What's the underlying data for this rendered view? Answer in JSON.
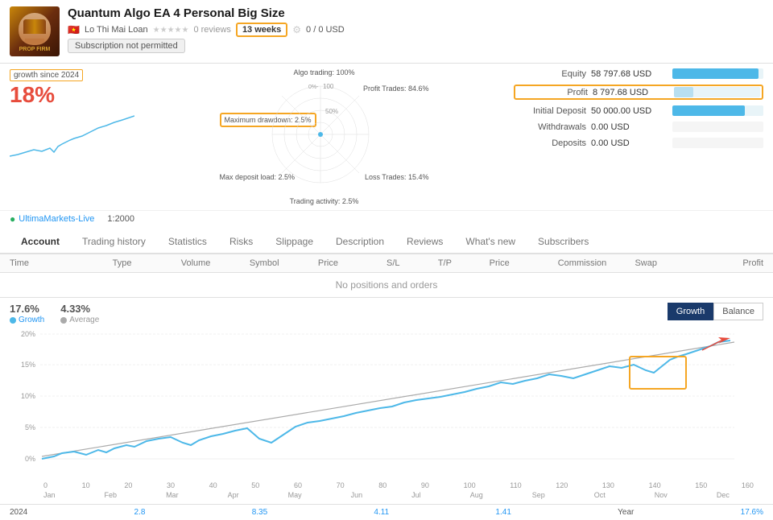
{
  "header": {
    "title": "Quantum Algo EA 4 Personal Big Size",
    "broker": "Lo Thi Mai Loan",
    "flag": "🇻🇳",
    "stars": "★★★★★",
    "reviews": "0 reviews",
    "weeks": "13 weeks",
    "usd_info": "0 / 0 USD",
    "subscription": "Subscription not permitted"
  },
  "growth": {
    "label": "growth since 2024",
    "value": "18%"
  },
  "radar": {
    "algo_trading": "Algo trading: 100%",
    "profit_trades": "Profit Trades:\n84.6%",
    "loss_trades": "Loss Trades: 15.4%",
    "trading_activity": "Trading activity: 2.5%",
    "max_drawdown": "Maximum\ndrawdown: 2.5%",
    "max_deposit_load": "Max deposit load:\n2.5%",
    "center_label": "50%"
  },
  "stats": {
    "equity_label": "Equity",
    "equity_value": "58 797.68 USD",
    "equity_bar_width": "95",
    "profit_label": "Profit",
    "profit_value": "8 797.68 USD",
    "profit_bar_width": "20",
    "initial_label": "Initial Deposit",
    "initial_value": "50 000.00 USD",
    "initial_bar_width": "80",
    "withdrawals_label": "Withdrawals",
    "withdrawals_value": "0.00 USD",
    "deposits_label": "Deposits",
    "deposits_value": "0.00 USD"
  },
  "footer": {
    "broker_live": "UltimaMarkets-Live",
    "leverage": "1:2000"
  },
  "tabs": [
    "Account",
    "Trading history",
    "Statistics",
    "Risks",
    "Slippage",
    "Description",
    "Reviews",
    "What's new",
    "Subscribers"
  ],
  "active_tab": "Account",
  "table_headers": [
    "Time",
    "Type",
    "Volume",
    "Symbol",
    "Price",
    "S/L",
    "T/P",
    "Price",
    "Commission",
    "Swap",
    "Profit"
  ],
  "no_data_msg": "No positions and orders",
  "chart": {
    "value1": "17.6%",
    "value2": "4.33%",
    "label1": "Growth",
    "label2": "Average",
    "btn_growth": "Growth",
    "btn_balance": "Balance",
    "y_labels": [
      "20%",
      "15%",
      "10%",
      "5%",
      "0%"
    ],
    "x_numbers": [
      "0",
      "10",
      "20",
      "30",
      "40",
      "50",
      "60",
      "70",
      "80",
      "90",
      "100",
      "110",
      "120",
      "130",
      "140",
      "150",
      "160"
    ],
    "month_labels": [
      "Jan",
      "Feb",
      "Mar",
      "Apr",
      "May",
      "Jun",
      "Jul",
      "Aug",
      "Sep",
      "Oct",
      "Nov",
      "Dec"
    ],
    "year_label": "2024",
    "year_values": [
      {
        "label": "2.8",
        "color": "blue"
      },
      {
        "label": "8.35",
        "color": "blue"
      },
      {
        "label": "4.11",
        "color": "blue"
      },
      {
        "label": "1.41",
        "color": "blue"
      },
      {
        "label": "17.6",
        "color": "blue"
      }
    ],
    "year_final": "Year",
    "year_value": "17.6%"
  }
}
